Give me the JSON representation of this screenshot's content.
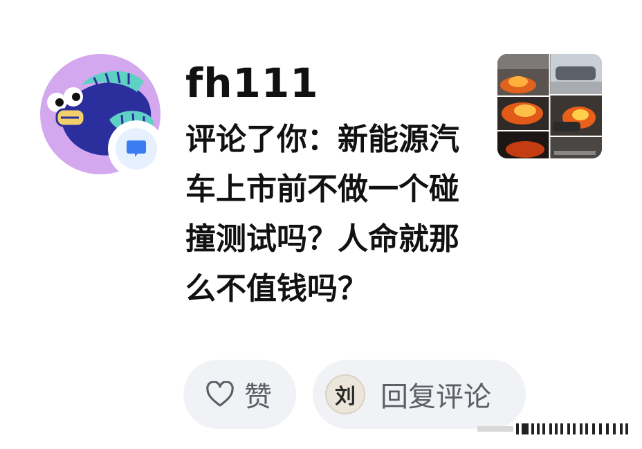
{
  "notification": {
    "username": "fh111",
    "comment_text": "评论了你：新能源汽车上市前不做一个碰撞测试吗？人命就那么不值钱吗？",
    "actions": {
      "like_label": "赞",
      "reply_label": "回复评论",
      "reply_avatar_char": "刘"
    }
  },
  "icons": {
    "back": "chevron-left-icon",
    "badge": "comment-bubble-icon",
    "like": "heart-outline-icon"
  },
  "colors": {
    "avatar_bg": "#d4a8ef",
    "fish_body": "#2b2f9e",
    "fish_fin": "#5fd0c4",
    "badge_icon": "#3a7cf2",
    "pill_bg": "#f1f2f5",
    "pill_text": "#5b5f66"
  }
}
